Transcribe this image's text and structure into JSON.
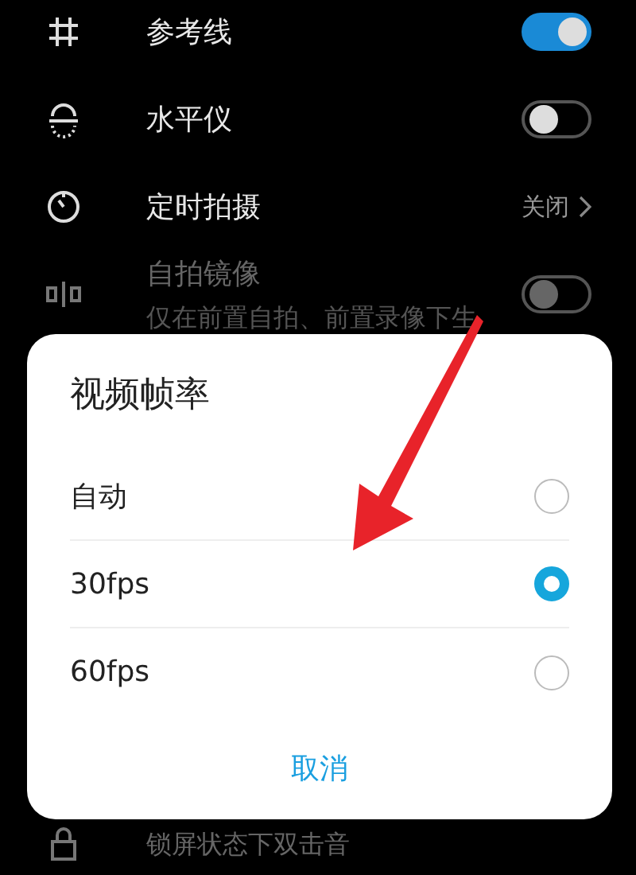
{
  "settings": [
    {
      "kind": "toggle",
      "title": "参考线",
      "on": true
    },
    {
      "kind": "toggle",
      "title": "水平仪",
      "on": false
    },
    {
      "kind": "value",
      "title": "定时拍摄",
      "value": "关闭"
    },
    {
      "kind": "toggle",
      "title": "自拍镜像",
      "subtitle": "仅在前置自拍、前置录像下生",
      "on": false,
      "disabled": true
    },
    {
      "kind": "text",
      "title": "锁屏状态下双击音"
    }
  ],
  "dialog": {
    "title": "视频帧率",
    "options": [
      {
        "label": "自动",
        "selected": false
      },
      {
        "label": "30fps",
        "selected": true
      },
      {
        "label": "60fps",
        "selected": false
      }
    ],
    "cancel": "取消"
  }
}
